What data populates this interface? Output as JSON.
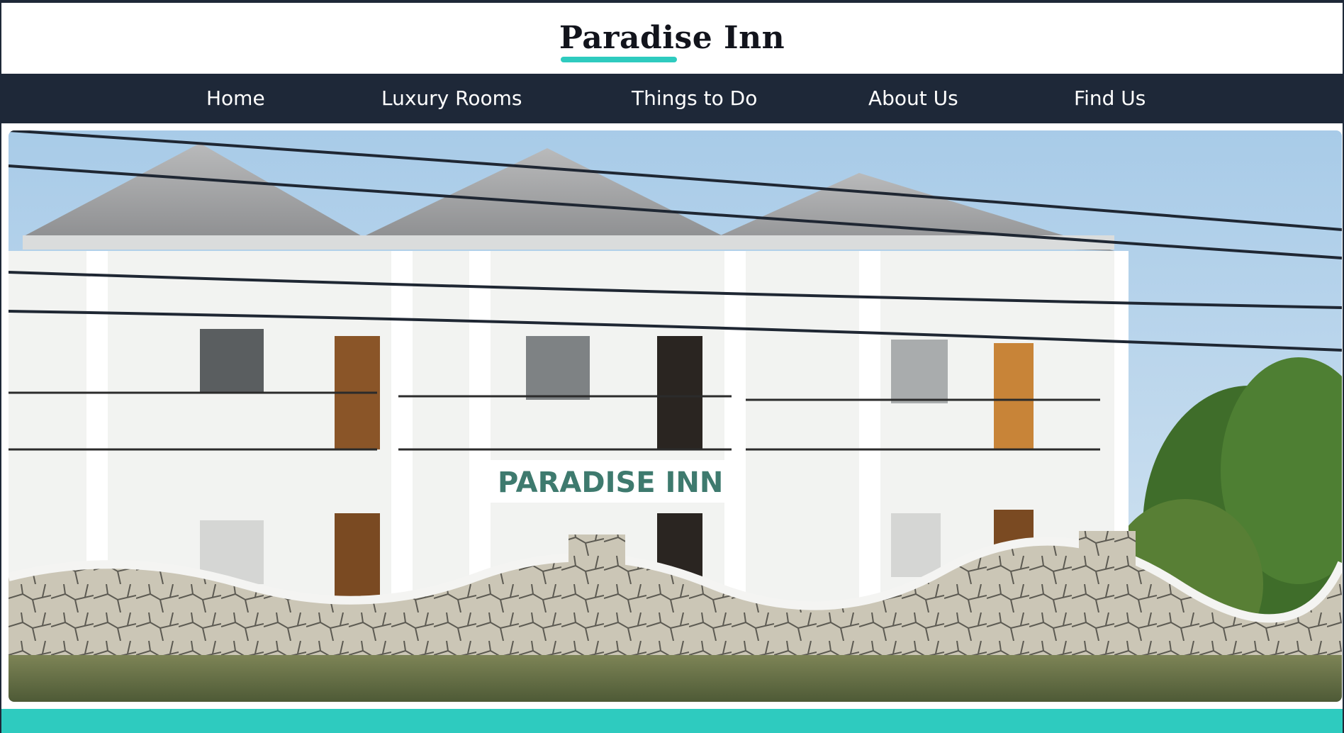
{
  "site": {
    "title": "Paradise Inn"
  },
  "nav": {
    "items": [
      {
        "label": "Home"
      },
      {
        "label": "Luxury Rooms"
      },
      {
        "label": "Things to Do"
      },
      {
        "label": "About Us"
      },
      {
        "label": "Find Us"
      }
    ]
  },
  "hero": {
    "sign_text": "PARADISE INN"
  },
  "colors": {
    "navy": "#1e2838",
    "teal": "#2ecbbf",
    "white": "#ffffff"
  }
}
